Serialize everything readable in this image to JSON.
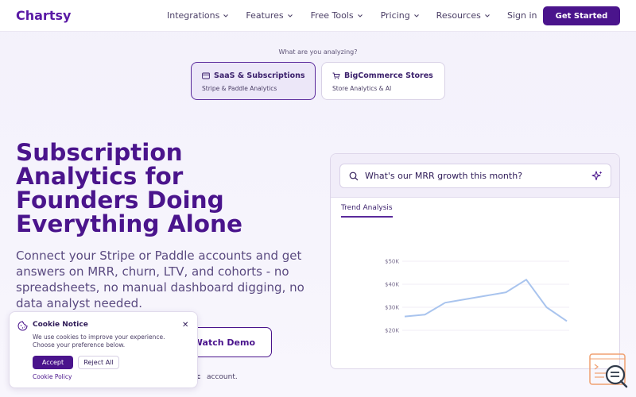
{
  "header": {
    "logo": "Chartsy",
    "nav": [
      {
        "label": "Integrations"
      },
      {
        "label": "Features"
      },
      {
        "label": "Free Tools"
      },
      {
        "label": "Pricing"
      },
      {
        "label": "Resources"
      }
    ],
    "sign_in": "Sign in",
    "cta": "Get Started"
  },
  "selector": {
    "label": "What are you analyzing?",
    "options": [
      {
        "title": "SaaS & Subscriptions",
        "subtitle": "Stripe & Paddle Analytics",
        "icon": "card-icon",
        "selected": true
      },
      {
        "title": "BigCommerce Stores",
        "subtitle": "Store Analytics & AI",
        "icon": "cart-icon",
        "selected": false
      }
    ]
  },
  "hero": {
    "title_lines": [
      "Subscription",
      "Analytics for",
      "Founders Doing",
      "Everything Alone"
    ],
    "subtitle_lines": [
      "Connect your Stripe or Paddle accounts and get",
      "answers on MRR, churn, LTV, and cohorts - no",
      "spreadsheets, no manual dashboard digging, no",
      "data analyst needed."
    ],
    "watch_demo": "Watch Demo",
    "account_fragment": "c",
    "account_text": "account."
  },
  "demo": {
    "query": "What's our MRR growth this month?",
    "tab": "Trend Analysis",
    "colors": {
      "line": "#a9c4ee",
      "grid": "#ece8f2"
    }
  },
  "chart_data": {
    "type": "line",
    "title": "",
    "xlabel": "",
    "ylabel": "",
    "y_tick_labels": [
      "$50K",
      "$40K",
      "$30K",
      "$20K"
    ],
    "y_ticks": [
      50000,
      40000,
      30000,
      20000
    ],
    "ylim": [
      20000,
      50000
    ],
    "grid": true,
    "series": [
      {
        "values": [
          26000,
          26800,
          32000,
          33500,
          35000,
          36500,
          42000,
          30000,
          24000
        ]
      }
    ]
  },
  "cookie": {
    "title": "Cookie Notice",
    "body_lines": [
      "We use cookies to improve your experience.",
      "Choose your preference below."
    ],
    "accept": "Accept",
    "reject": "Reject All",
    "policy": "Cookie Policy"
  },
  "colors": {
    "brand": "#4a148c",
    "accent": "#5a1aa5",
    "text": "#2e1a57"
  }
}
